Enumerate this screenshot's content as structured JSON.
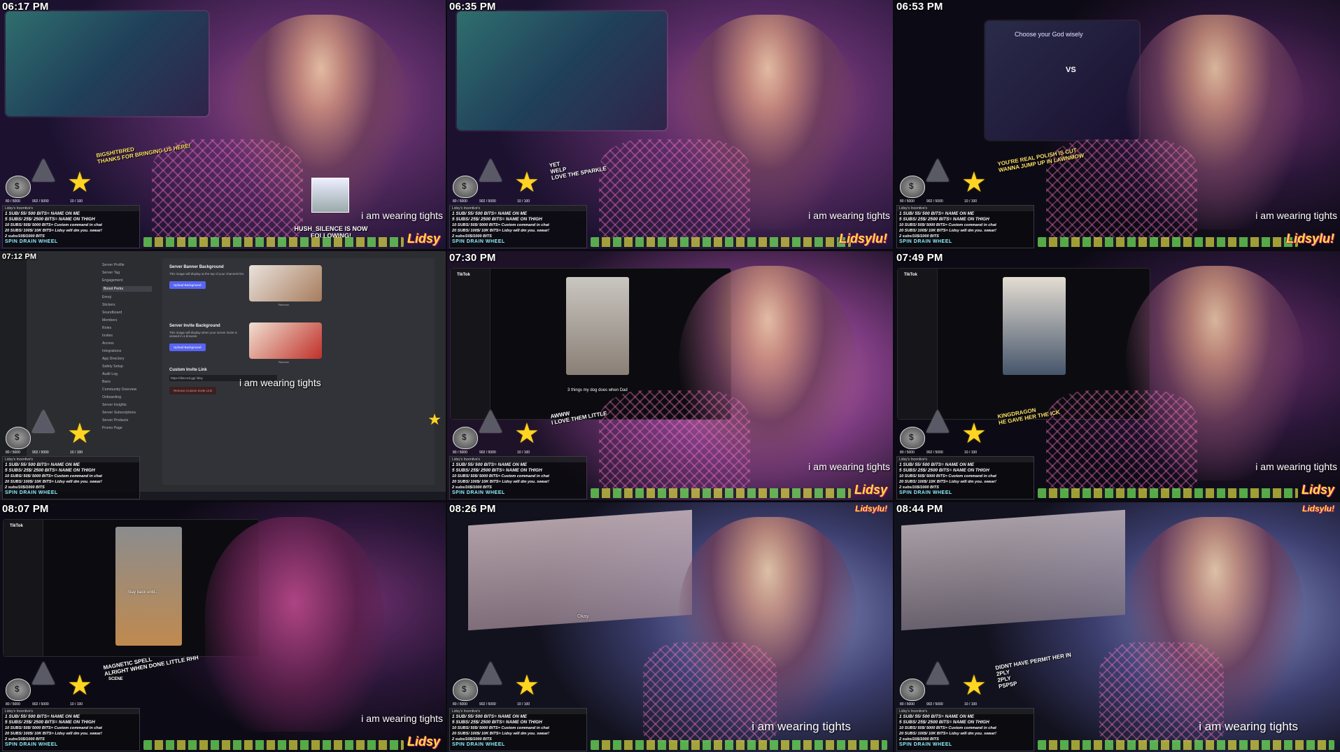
{
  "caption_text": "i am wearing tights",
  "hud": {
    "counter_a": "80 / 5000",
    "counter_b": "902 / 5000",
    "counter_c": "10 / 100",
    "box_title": "Lidsy's Incentive's",
    "lines": [
      "1 SUB/ 55/ 500 BITS= NAME ON ME",
      "5 SUBS/ 25$/ 2500 BITS= NAME ON THIGH",
      "10 SUBS/ 50$/ 5000 BITS= Custom command in chat",
      "20 SUBS/ 100$/ 10K BITS= Lidsy will dm you. swear!",
      "2 subs/10$/1000 BITS"
    ],
    "wheel": "SPIN DRAIN WHEEL",
    "brand": "Lidsy",
    "brand_alt": "Lidsylu!"
  },
  "tiles": [
    {
      "time": "06:17 PM",
      "alerts": [
        "BIGSHITBRED",
        "THANKS FOR BRINGING US HERE!"
      ],
      "follower": "HUSH_SILENCE IS NOW FOLLOWING!"
    },
    {
      "time": "06:35 PM",
      "alerts": [
        "YET",
        "WELP",
        "LOVE THE SPARKLE"
      ]
    },
    {
      "time": "06:53 PM",
      "dialog_title": "Choose your God wisely",
      "dialog_vs": "VS",
      "alerts": [
        "YOU'RE REAL POLISH IS CUT",
        "WANNA JUMP UP IN LAWNMOW"
      ]
    },
    {
      "time": "07:12 PM",
      "discord": {
        "nav": [
          "Server Profile",
          "Server Tag",
          "Engagement",
          "Boost Perks",
          "Emoji",
          "Stickers",
          "Soundboard",
          "Members",
          "Roles",
          "Invites",
          "Access",
          "Integrations",
          "App Directory",
          "Safety Setup",
          "Audit Log",
          "Bans",
          "Community Overview",
          "Onboarding",
          "Server Insights",
          "Server Subscriptions",
          "Server Products",
          "Promo Page"
        ],
        "active_index": 3,
        "banner_title": "Server Banner Background",
        "banner_text": "This image will display at the top of your channels list.",
        "upload_label": "Upload Background",
        "invite_title": "Server Invite Background",
        "invite_text": "This image will display when your server invite is viewed in a browser.",
        "invite_link_title": "Custom Invite Link",
        "invite_input": "https://discord.gg/ lidsy",
        "remove_label": "Remove Custom Invite Link",
        "remove_thumb": "Remove"
      }
    },
    {
      "time": "07:30 PM",
      "tiktok": "TikTok",
      "media_caption": "3 things my dog does when Dad",
      "alerts": [
        "AWWW",
        "I LOVE THEM LITTLE"
      ]
    },
    {
      "time": "07:49 PM",
      "tiktok": "TikTok",
      "alerts": [
        "KINGDRAGON",
        "HE GAVE HER THE ICK"
      ]
    },
    {
      "time": "08:07 PM",
      "tiktok": "TikTok",
      "media_caption": "Stay back until...",
      "alerts": [
        "MAGNETIC SPELL",
        "ALRIGHT WHEN DONE LITTLE RHH"
      ],
      "extra": "SCENE"
    },
    {
      "time": "08:26 PM",
      "film_caption": "Okay."
    },
    {
      "time": "08:44 PM",
      "alerts": [
        "DIDNT HAVE PERMIT HER IN",
        "2PLY",
        "2PLY",
        "PSPSP"
      ]
    }
  ],
  "colors": {
    "star": "#ffd422",
    "brand": "#ffdf3a",
    "discord_button": "#5865f2"
  }
}
